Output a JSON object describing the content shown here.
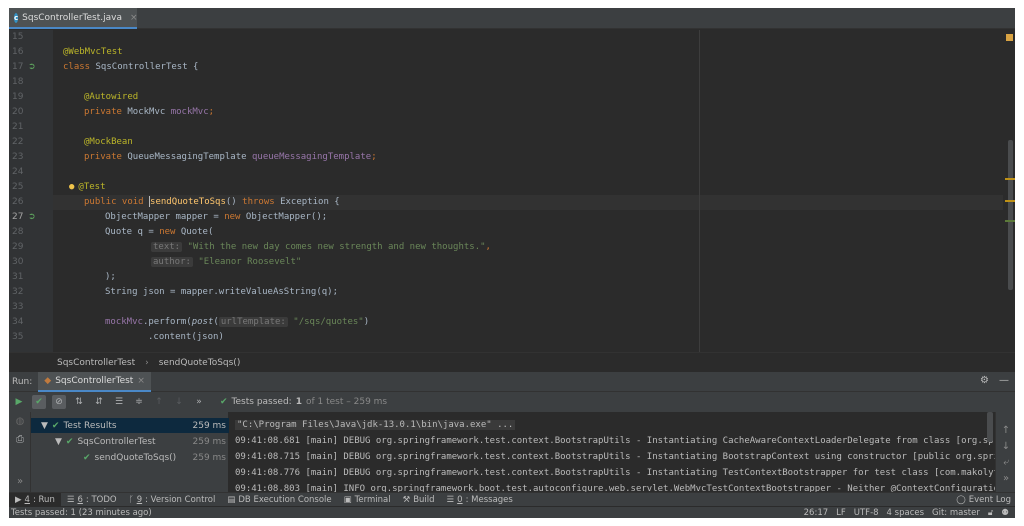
{
  "editor_tab": {
    "filename": "SqsControllerTest.java",
    "close_glyph": "×"
  },
  "gutter": {
    "lines": [
      "15",
      "16",
      "17",
      "18",
      "19",
      "20",
      "21",
      "22",
      "23",
      "24",
      "25",
      "26",
      "27",
      "28",
      "29",
      "30",
      "31",
      "32",
      "33",
      "34",
      "35"
    ]
  },
  "code": {
    "l16": {
      "ann": "@WebMvcTest"
    },
    "l17": {
      "kw": "class ",
      "name": "SqsControllerTest {"
    },
    "l19": {
      "ann": "@Autowired"
    },
    "l20": {
      "kw": "private ",
      "type": "MockMvc ",
      "field": "mockMvc",
      "end": ";"
    },
    "l22": {
      "ann": "@MockBean"
    },
    "l23": {
      "kw": "private ",
      "type": "QueueMessagingTemplate ",
      "field": "queueMessagingTemplate",
      "end": ";"
    },
    "l25": {
      "ann": "@Test"
    },
    "l26": {
      "kw1": "public void ",
      "method": "sendQuoteToSqs",
      "mid": "() ",
      "kw2": "throws ",
      "rest": "Exception {"
    },
    "l27": {
      "text1": "ObjectMapper mapper = ",
      "kw": "new ",
      "text2": "ObjectMapper();"
    },
    "l28": {
      "text1": "Quote q = ",
      "kw": "new ",
      "text2": "Quote("
    },
    "l29": {
      "hint": "text:",
      "str": "\"With the new day comes new strength and new thoughts.\"",
      "end": ","
    },
    "l30": {
      "hint": "author:",
      "str": "\"Eleanor Roosevelt\""
    },
    "l31": {
      "text": ");"
    },
    "l32": {
      "text": "String json = mapper.writeValueAsString(q);"
    },
    "l34": {
      "field": "mockMvc",
      "text1": ".perform(",
      "italic": "post",
      "text2": "(",
      "hint": "urlTemplate:",
      "str": "\"/sqs/quotes\"",
      "end": ")"
    },
    "l35": {
      "text": ".content(json)"
    }
  },
  "breadcrumb": {
    "class_name": "SqsControllerTest",
    "sep": "›",
    "method_name": "sendQuoteToSqs()"
  },
  "run_panel": {
    "label": "Run:",
    "tab": "SqsControllerTest",
    "close_glyph": "×",
    "tests_passed_label": "Tests passed:",
    "tests_passed_count": "1",
    "tests_passed_detail": "of 1 test – 259 ms"
  },
  "tree": {
    "rows": [
      {
        "label": "Test Results",
        "duration": "259 ms"
      },
      {
        "label": "SqsControllerTest",
        "duration": "259 ms"
      },
      {
        "label": "sendQuoteToSqs()",
        "duration": "259 ms"
      }
    ]
  },
  "console": {
    "lines": [
      "\"C:\\Program Files\\Java\\jdk-13.0.1\\bin\\java.exe\" ...",
      "09:41:08.681 [main] DEBUG org.springframework.test.context.BootstrapUtils - Instantiating CacheAwareContextLoaderDelegate from class [org.spri",
      "09:41:08.715 [main] DEBUG org.springframework.test.context.BootstrapUtils - Instantiating BootstrapContext using constructor [public org.sprin",
      "09:41:08.776 [main] DEBUG org.springframework.test.context.BootstrapUtils - Instantiating TestContextBootstrapper for test class [com.makolyte",
      "09:41:08.803 [main] INFO org.springframework.boot.test.autoconfigure.web.servlet.WebMvcTestContextBootstrapper - Neither @ContextConfiguration"
    ]
  },
  "tool_windows": {
    "run": {
      "num": "4",
      "label": ": Run"
    },
    "todo": {
      "num": "6",
      "label": ": TODO"
    },
    "vcs": {
      "num": "9",
      "label": ": Version Control"
    },
    "db": {
      "label": "DB Execution Console"
    },
    "terminal": {
      "label": "Terminal"
    },
    "build": {
      "label": "Build"
    },
    "messages": {
      "num": "0",
      "label": ": Messages"
    },
    "event_log": {
      "label": "Event Log"
    }
  },
  "status_bar": {
    "message": "Tests passed: 1 (23 minutes ago)",
    "position": "26:17",
    "line_sep": "LF",
    "encoding": "UTF-8",
    "indent": "4 spaces",
    "git": "Git: master"
  },
  "colors": {
    "background": "#2b2b2b",
    "panel": "#3c3f41",
    "keyword": "#cc7832",
    "annotation": "#bbb529",
    "string": "#6a8759",
    "field": "#9876aa",
    "method": "#ffc66d",
    "pass_green": "#59a869",
    "accent": "#4a88c7"
  }
}
